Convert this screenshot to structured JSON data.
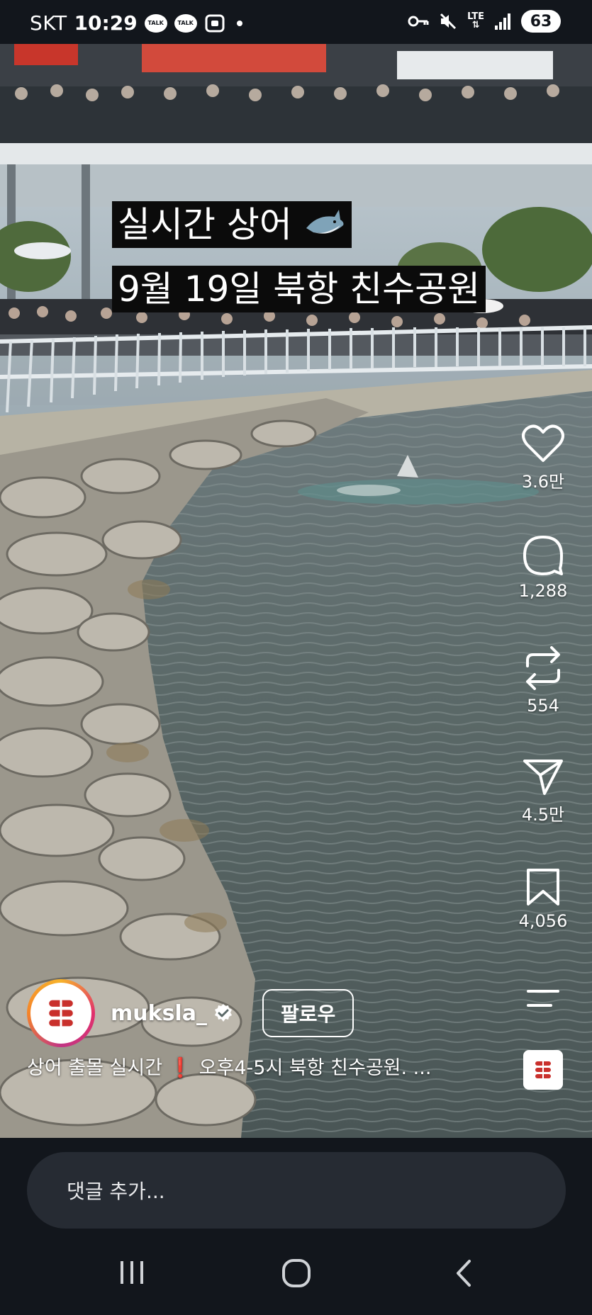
{
  "status_bar": {
    "carrier": "SKT",
    "time": "10:29",
    "notif_1": "TALK",
    "notif_2": "TALK",
    "network": "LTE",
    "battery": "63",
    "icons": [
      "kakaotalk-icon",
      "kakaotalk-icon",
      "screenshot-icon",
      "dot-icon",
      "key-icon",
      "mute-icon",
      "lte-icon",
      "signal-icon",
      "battery-icon"
    ]
  },
  "video": {
    "caption_line1": "실시간 상어",
    "caption_emoji": "shark-emoji",
    "caption_line2": "9월 19일 북항 친수공원"
  },
  "actions": {
    "likes": "3.6만",
    "comments": "1,288",
    "reposts": "554",
    "shares": "4.5만",
    "saves": "4,056",
    "icons": [
      "heart-icon",
      "comment-icon",
      "repost-icon",
      "send-icon",
      "bookmark-icon",
      "more-icon"
    ]
  },
  "post": {
    "username": "muksla_",
    "follow_label": "팔로우",
    "description": "상어 출몰 실시간 ❗️ 오후4-5시 북항 친수공원. ...",
    "desc_part1": "상어 출몰 실시간",
    "desc_part2": "오후4-5시 북항 친수공원. ..."
  },
  "comment_bar": {
    "placeholder": "댓글 추가..."
  },
  "nav": {
    "icons": [
      "recent-apps-icon",
      "home-icon",
      "back-icon"
    ]
  },
  "colors": {
    "background": "#12161c",
    "input_bg": "#262b33",
    "accent_red": "#e0334b"
  }
}
